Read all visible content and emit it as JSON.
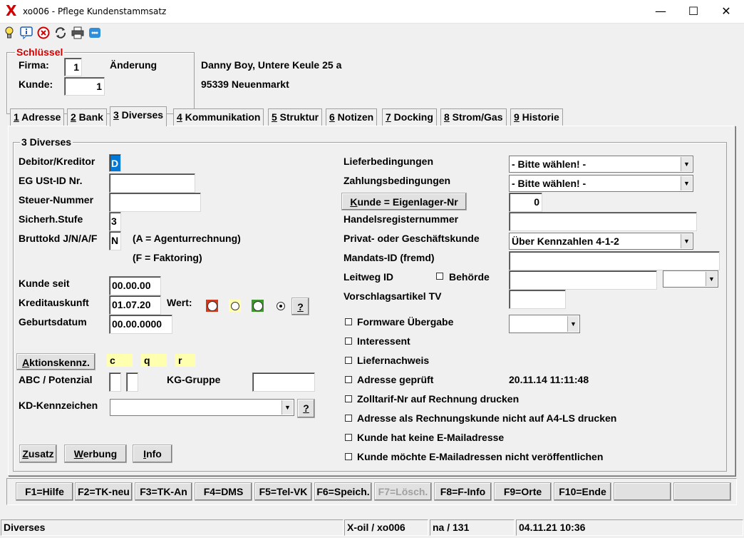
{
  "window": {
    "logo": "X",
    "title": "xo006 - Pflege Kundenstammsatz",
    "minimize": "—",
    "maximize": "☐",
    "close": "✕"
  },
  "toolbar": {
    "icons": [
      "lightbulb-icon",
      "info-chat-icon",
      "cancel-icon",
      "refresh-icon",
      "print-icon",
      "chat-icon"
    ]
  },
  "schluessel": {
    "legend": "Schlüssel",
    "firma_label": "Firma:",
    "firma_value": "1",
    "kunde_label": "Kunde:",
    "kunde_value": "1",
    "mode": "Änderung"
  },
  "address": {
    "line1": "Danny Boy, Untere Keule 25 a",
    "line2": "95339 Neuenmarkt"
  },
  "tabs": [
    {
      "num": "1",
      "label": " Adresse"
    },
    {
      "num": "2",
      "label": " Bank"
    },
    {
      "num": "3",
      "label": " Diverses"
    },
    {
      "num": "4",
      "label": " Kommunikation"
    },
    {
      "num": "5",
      "label": " Struktur"
    },
    {
      "num": "6",
      "label": " Notizen"
    },
    {
      "num": "7",
      "label": " Docking"
    },
    {
      "num": "8",
      "label": " Strom/Gas"
    },
    {
      "num": "9",
      "label": " Historie"
    }
  ],
  "panel": {
    "legend": "3 Diverses",
    "left": {
      "debitor_label": "Debitor/Kreditor",
      "debitor_value": "D",
      "egust_label": "EG USt-ID Nr.",
      "egust_value": "",
      "steuer_label": "Steuer-Nummer",
      "steuer_value": "",
      "sicherh_label": "Sicherh.Stufe",
      "sicherh_value": "3",
      "brutto_label": "Bruttokd J/N/A/F",
      "brutto_value": "N",
      "brutto_note1": "(A = Agenturrechnung)",
      "brutto_note2": "(F = Faktoring)",
      "kundeseit_label": "Kunde seit",
      "kundeseit_value": "00.00.00",
      "kredit_label": "Kreditauskunft",
      "kredit_value": "01.07.20",
      "wert_label": "Wert:",
      "wert_help": "?",
      "geburt_label": "Geburtsdatum",
      "geburt_value": "00.00.0000",
      "aktion_button_u": "A",
      "aktion_button": "ktionskennz.",
      "aktion_tags": [
        "c",
        "q",
        "r"
      ],
      "abc_label": "ABC / Potenzial",
      "kg_label": "KG-Gruppe",
      "kg_value": "",
      "kdkz_label": "KD-Kennzeichen",
      "kdkz_value": "",
      "kdkz_help": "?",
      "zusatz_u": "Z",
      "zusatz": "usatz",
      "werbung_u": "W",
      "werbung": "erbung",
      "info_u": "I",
      "info": "nfo"
    },
    "right": {
      "liefer_label": "Lieferbedingungen",
      "liefer_value": "- Bitte wählen! -",
      "zahlung_label": "Zahlungsbedingungen",
      "zahlung_value": "- Bitte wählen! -",
      "eigenlager_u": "K",
      "eigenlager": "unde = Eigenlager-Nr",
      "eigenlager_value": "0",
      "handels_label": "Handelsregisternummer",
      "handels_value": "",
      "privat_label": "Privat- oder Geschäftskunde",
      "privat_value": "Über Kennzahlen 4-1-2",
      "mandat_label": "Mandats-ID (fremd)",
      "mandat_value": "",
      "leitweg_label": "Leitweg ID",
      "behoerde_label": "Behörde",
      "leitweg_value": "",
      "vorschlag_label": "Vorschlagsartikel TV",
      "vorschlag_value": "",
      "formware_label": "Formware Übergabe",
      "interessent_label": "Interessent",
      "liefernachweis_label": "Liefernachweis",
      "geprueft_label": "Adresse geprüft",
      "geprueft_date": "20.11.14 11:11:48",
      "zolltarif_label": "Zolltarif-Nr auf Rechnung drucken",
      "a4ls_label": "Adresse als Rechnungskunde nicht auf A4-LS drucken",
      "keinemail_label": "Kunde hat keine E-Mailadresse",
      "nichtveroeff_label": "Kunde möchte E-Mailadressen nicht veröffentlichen"
    }
  },
  "fkeys": [
    {
      "label": "F1=Hilfe",
      "enabled": true
    },
    {
      "label": "F2=TK-neu",
      "enabled": true
    },
    {
      "label": "F3=TK-An",
      "enabled": true
    },
    {
      "label": "F4=DMS",
      "enabled": true
    },
    {
      "label": "F5=Tel-VK",
      "enabled": true
    },
    {
      "label": "F6=Speich.",
      "enabled": true
    },
    {
      "label": "F7=Lösch.",
      "enabled": false
    },
    {
      "label": "F8=F-Info",
      "enabled": true
    },
    {
      "label": "F9=Orte",
      "enabled": true
    },
    {
      "label": "F10=Ende",
      "enabled": true
    },
    {
      "label": "",
      "enabled": true
    },
    {
      "label": "",
      "enabled": true
    }
  ],
  "status": {
    "section": "Diverses",
    "app": "X-oil / xo006",
    "user": "na / 131",
    "datetime": "04.11.21 10:36"
  },
  "colors": {
    "accent_red": "#d40000",
    "tag_yellow": "#ffffb0",
    "focus_blue": "#0078d7"
  }
}
